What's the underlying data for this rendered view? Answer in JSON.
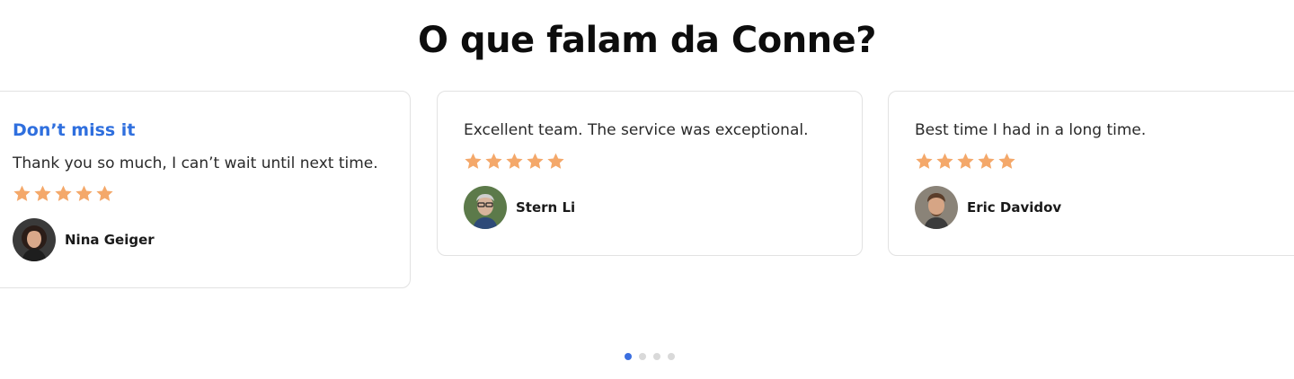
{
  "section": {
    "heading": "O que falam da Conne?"
  },
  "testimonials": [
    {
      "title": "Don’t miss it",
      "quote": "Thank you so much, I can’t wait until next time.",
      "rating": 5,
      "author": "Nina Geiger"
    },
    {
      "quote": "Excellent team. The service was exceptional.",
      "rating": 5,
      "author": "Stern Li"
    },
    {
      "quote": "Best time I had in a long time.",
      "rating": 5,
      "author": "Eric Davidov"
    }
  ],
  "carousel": {
    "total_pages": 4,
    "active_page": 1
  },
  "colors": {
    "accent": "#2f6fde",
    "star": "#f4a86a",
    "dot_active": "#3b6fe0",
    "dot_inactive": "#d9d9d9"
  },
  "icons": {
    "star": "star-icon",
    "avatar": "avatar"
  }
}
